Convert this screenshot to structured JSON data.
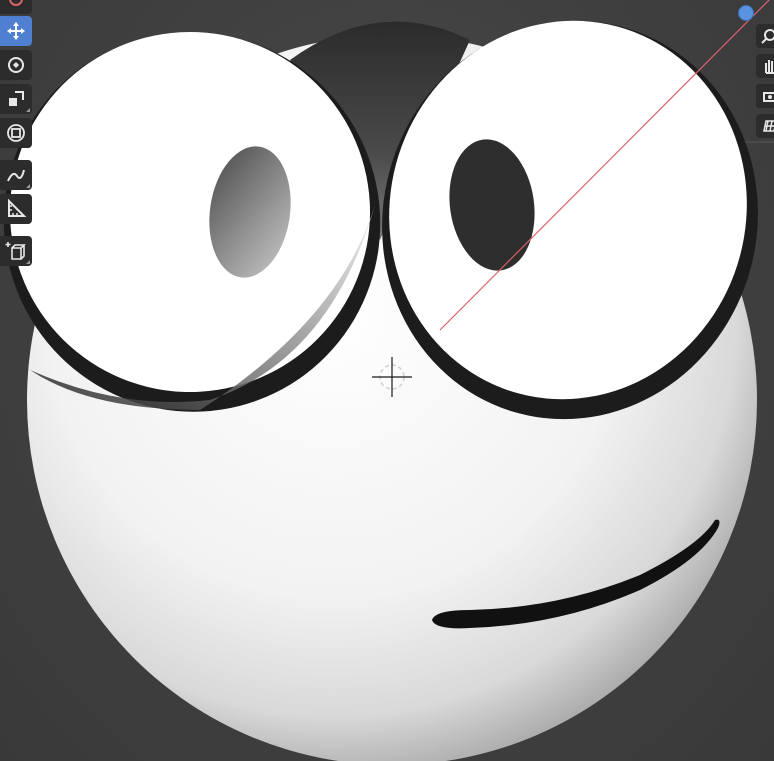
{
  "viewport": {
    "background": "#3f3f3f",
    "grid_line_color": "#5a5a5a",
    "x_axis_color": "#d9606a"
  },
  "toolbar": {
    "active_color": "#4f7fd1",
    "tools": [
      {
        "name": "cursor-tool",
        "icon": "cursor-icon"
      },
      {
        "name": "move-tool",
        "icon": "move-arrows-icon",
        "active": true
      },
      {
        "name": "rotate-tool",
        "icon": "rotate-icon"
      },
      {
        "name": "scale-tool",
        "icon": "scale-icon"
      },
      {
        "name": "transform-tool",
        "icon": "transform-icon"
      },
      {
        "name": "annotate-tool",
        "icon": "annotate-pen-icon"
      },
      {
        "name": "measure-tool",
        "icon": "ruler-icon"
      },
      {
        "name": "add-cube-tool",
        "icon": "add-cube-icon"
      }
    ]
  },
  "navigation": {
    "buttons": [
      {
        "name": "zoom-button",
        "icon": "magnifier-icon"
      },
      {
        "name": "pan-button",
        "icon": "hand-icon"
      },
      {
        "name": "camera-button",
        "icon": "camera-icon"
      },
      {
        "name": "perspective-button",
        "icon": "grid-icon"
      }
    ],
    "gizmo_color": "#5a93e0"
  },
  "object": {
    "body_color": "#f2f2f2",
    "eye_outline_color": "#1e1e1e",
    "pupil_color": "#2e2e2e",
    "mouth_color": "#111111"
  }
}
